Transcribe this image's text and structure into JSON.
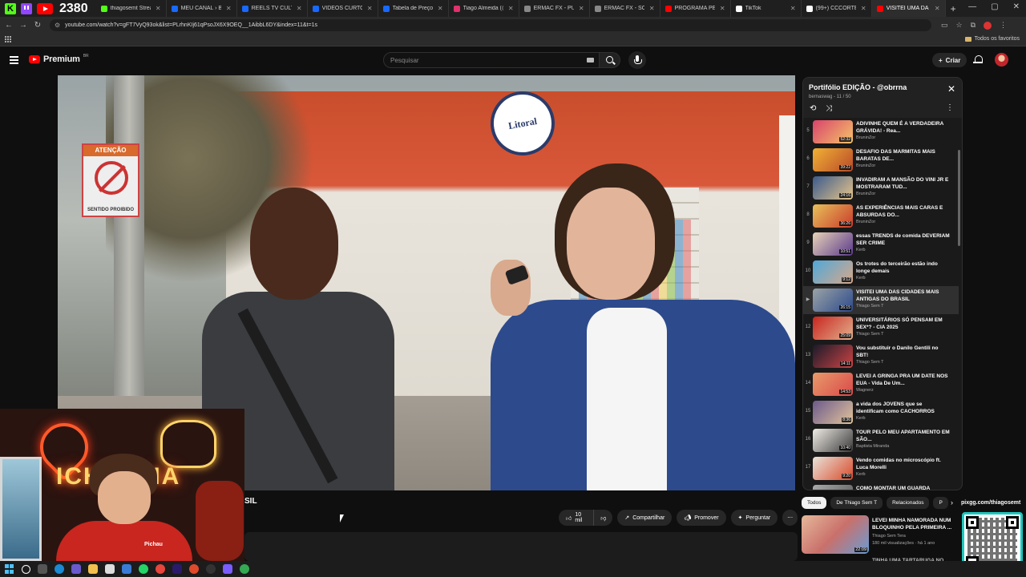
{
  "browser": {
    "counter": "2380",
    "tabs": [
      {
        "title": "thiagosemt Stream",
        "color": "#53fc18"
      },
      {
        "title": "MEU CANAL › Beha",
        "color": "#1769ff"
      },
      {
        "title": "REELS TV CULTURA",
        "color": "#1769ff"
      },
      {
        "title": "VIDEOS CURTOS - ",
        "color": "#1769ff"
      },
      {
        "title": "Tabela de Preços / ",
        "color": "#1769ff"
      },
      {
        "title": "Tiago Almeida (@c",
        "color": "#e1306c"
      },
      {
        "title": "ERMAC FX - PUBLIC",
        "color": "#888888"
      },
      {
        "title": "ERMAC FX - SOBRE",
        "color": "#888888"
      },
      {
        "title": "PROGRAMA PÉ NA",
        "color": "#ff0000"
      },
      {
        "title": "TikTok",
        "color": "#ffffff"
      },
      {
        "title": "(99+) CCCORTES",
        "color": "#ffffff"
      },
      {
        "title": "VISITEI UMA DA",
        "color": "#ff0000"
      }
    ],
    "url": "youtube.com/watch?v=gFT7VyQ93ok&list=PLrhnKIj61qPsoJX6X9OEQ__1AibbL6DY&index=11&t=1s",
    "bookmarks_label": "Todos os favoritos"
  },
  "youtube": {
    "logo_text": "Premium",
    "logo_region": "BR",
    "search_placeholder": "Pesquisar",
    "create_label": "Criar"
  },
  "video": {
    "sign_header": "ATENÇÃO",
    "sign_footer": "SENTIDO PROIBIDO",
    "store_sign": "Litoral",
    "title_fragment": "SIL",
    "like_count": "10 mil",
    "share_label": "Compartilhar",
    "promote_label": "Promover",
    "ask_label": "Perguntar"
  },
  "playlist": {
    "title": "Portifólio EDIÇÃO - @obrrna",
    "subtitle": "bernaswag - 11 / 50",
    "items": [
      {
        "num": "5",
        "title": "ADIVINHE QUEM É A VERDADEIRA GRÁVIDA! - Rea...",
        "channel": "BruninZor",
        "duration": "52:32",
        "colors": [
          "#d9436b",
          "#f5c46a"
        ]
      },
      {
        "num": "6",
        "title": "DESAFIO DAS MARMITAS MAIS BARATAS DE...",
        "channel": "BruninZor",
        "duration": "39:22",
        "colors": [
          "#f2b134",
          "#b84a2a"
        ]
      },
      {
        "num": "7",
        "title": "INVADIRAM A MANSÃO DO VINI JR E MOSTRARAM TUD...",
        "channel": "BruninZor",
        "duration": "24:16",
        "colors": [
          "#3b5b8c",
          "#e7c48a"
        ]
      },
      {
        "num": "8",
        "title": "AS EXPERIÊNCIAS MAIS CARAS E ABSURDAS DO...",
        "channel": "BruninZor",
        "duration": "36:26",
        "colors": [
          "#e8c15a",
          "#c93b2c"
        ]
      },
      {
        "num": "9",
        "title": "essas TRENDS de comida DEVERIAM SER CRIME",
        "channel": "Kerb",
        "duration": "10:51",
        "colors": [
          "#e8d3b8",
          "#5a3a8c"
        ]
      },
      {
        "num": "10",
        "title": "Os trotes do terceirão estão indo longe demais",
        "channel": "Kerb",
        "duration": "9:12",
        "colors": [
          "#4fa7d9",
          "#d8a98a"
        ]
      },
      {
        "num": "▶",
        "title": "VISITEI UMA DAS CIDADES MAIS ANTIGAS DO BRASIL",
        "channel": "Thiago Sem T",
        "duration": "26:15",
        "colors": [
          "#9aa3a5",
          "#2d4a8c"
        ],
        "current": true
      },
      {
        "num": "12",
        "title": "UNIVERSITÁRIOS SÓ PENSAM EM SEX*? - CIA 2025",
        "channel": "Thiago Sem T",
        "duration": "25:09",
        "colors": [
          "#c8261f",
          "#e3b08e"
        ]
      },
      {
        "num": "13",
        "title": "Vou substituir o Danilo Gentili no SBT!",
        "channel": "Thiago Sem T",
        "duration": "14:11",
        "colors": [
          "#1a1a2a",
          "#c44"
        ]
      },
      {
        "num": "14",
        "title": "LEVEI A GRINGA PRA UM DATE NOS EUA - Vida De Um...",
        "channel": "Wagnerz",
        "duration": "14:53",
        "colors": [
          "#e89a6a",
          "#d94a4a"
        ]
      },
      {
        "num": "15",
        "title": "a vida dos JOVENS que se identificam como CACHORROS",
        "channel": "Kerb",
        "duration": "8:36",
        "colors": [
          "#6b5a8c",
          "#e3c49a"
        ]
      },
      {
        "num": "16",
        "title": "TOUR PELO MEU APARTAMENTO EM SÃO...",
        "channel": "Baptista Miranda",
        "duration": "10:40",
        "colors": [
          "#f0ece6",
          "#3a3a3a"
        ]
      },
      {
        "num": "17",
        "title": "Vendo comidas no microscópio ft. Luca Morelli",
        "channel": "Kerb",
        "duration": "9:20",
        "colors": [
          "#e9e3da",
          "#d94a2a"
        ]
      },
      {
        "num": "18",
        "title": "COMO MONTAR UM GUARDA",
        "channel": "",
        "duration": "",
        "colors": [
          "#aaaaaa",
          "#555555"
        ]
      }
    ]
  },
  "chips": [
    "Todos",
    "De Thiago Sem T",
    "Relacionados",
    "P"
  ],
  "related": {
    "title": "LEVEI MINHA NAMORADA NUM BLOQUINHO PELA PRIMEIRA ...",
    "channel": "Thiago Sem Tera",
    "meta": "180 mil visualizações · há 1 ano",
    "duration": "22:09",
    "next_title": "TINHA UMA TARTARUGA NO"
  },
  "webcam": {
    "neon_text": "ICHA",
    "neon_text2": "IA",
    "shirt_brand": "Pichau"
  },
  "qr_overlay": {
    "url": "pixgg.com/thiagosemt"
  },
  "colors": {
    "youtube_red": "#ff0000",
    "background": "#0f0f0f",
    "accent_cyan": "#1cc8c0"
  }
}
